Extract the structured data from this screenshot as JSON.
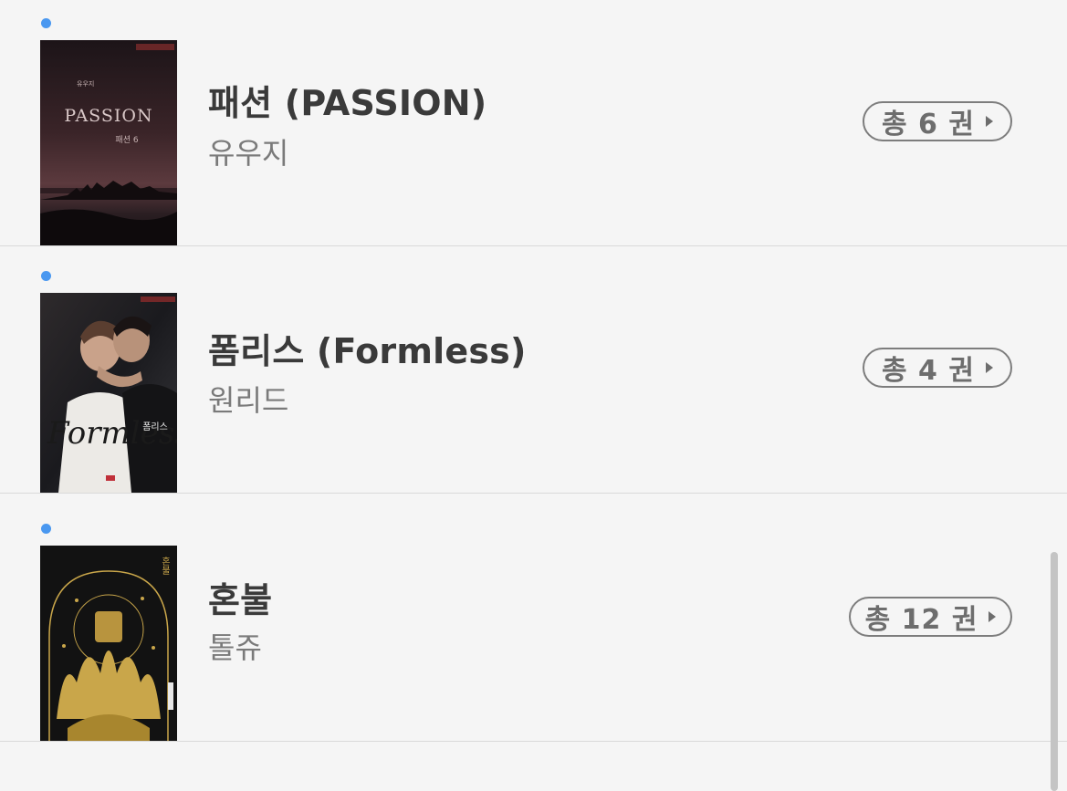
{
  "books": [
    {
      "title": "패션 (PASSION)",
      "author": "유우지",
      "volume_label": "총 6 권",
      "unread": true,
      "cover": {
        "text_main": "PASSION",
        "text_author": "유우지",
        "text_vol": "패션 6",
        "palette": [
          "#2a1c22",
          "#5a3a40",
          "#1a1418"
        ]
      }
    },
    {
      "title": "폼리스 (Formless)",
      "author": "원리드",
      "volume_label": "총 4 권",
      "unread": true,
      "cover": {
        "text_main": "Formless",
        "text_title_ko": "폼리스",
        "palette": [
          "#1e1e22",
          "#e8e6e2",
          "#2a2a2e"
        ]
      }
    },
    {
      "title": "혼불",
      "author": "톨쥬",
      "volume_label": "총 12 권",
      "unread": true,
      "cover": {
        "text_title_ko": "혼불",
        "palette": [
          "#141414",
          "#c9a64a",
          "#0a0a0a"
        ]
      }
    }
  ],
  "icons": {
    "unread": "unread-dot-icon",
    "pill_arrow": "play-arrow-icon"
  },
  "colors": {
    "background": "#f5f5f5",
    "unread_dot": "#4a98f0",
    "title": "#3a3a3a",
    "author": "#7a7a7a",
    "pill_border": "#7d7d7d"
  }
}
